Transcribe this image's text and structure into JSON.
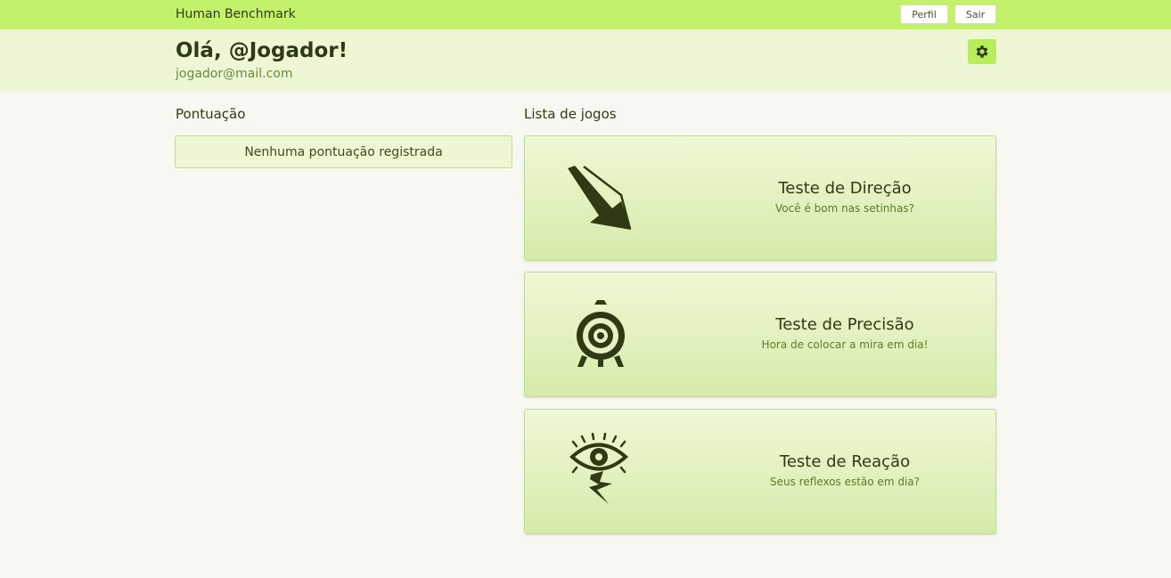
{
  "header": {
    "brand": "Human Benchmark",
    "buttons": {
      "profile": "Perfil",
      "logout": "Sair"
    }
  },
  "user": {
    "greeting": "Olá, @Jogador!",
    "email": "jogador@mail.com",
    "settings_icon": "gear-icon"
  },
  "scores": {
    "title": "Pontuação",
    "empty_message": "Nenhuma pontuação registrada"
  },
  "games": {
    "title": "Lista de jogos",
    "items": [
      {
        "title": "Teste de Direção",
        "subtitle": "Você é bom nas setinhas?",
        "icon": "arrow-icon"
      },
      {
        "title": "Teste de Precisão",
        "subtitle": "Hora de colocar a mira em dia!",
        "icon": "target-icon"
      },
      {
        "title": "Teste de Reação",
        "subtitle": "Seus reflexos estão em dia?",
        "icon": "eye-lightning-icon"
      }
    ]
  },
  "colors": {
    "accent": "#c3f26a",
    "text_dark": "#2f3a14",
    "panel": "#eff6d6"
  }
}
